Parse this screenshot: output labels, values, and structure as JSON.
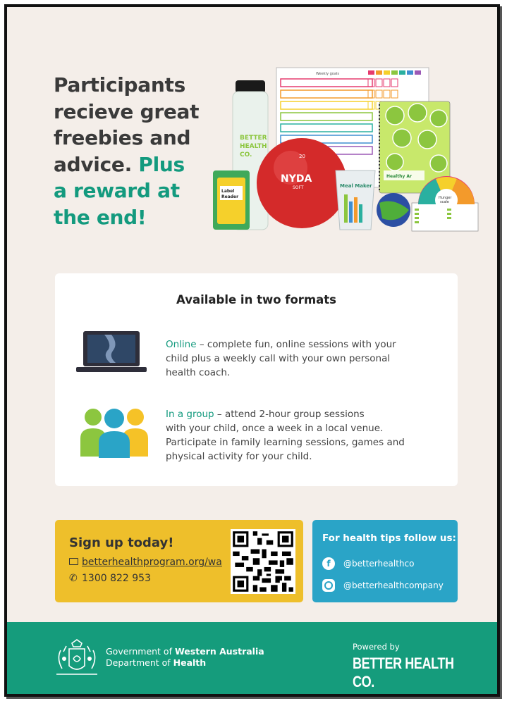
{
  "headline": {
    "line1": "Participants",
    "line2": "recieve great",
    "line3": "freebies and",
    "line4_start": "advice.",
    "line4_green": "Plus",
    "line5_green": "a reward at",
    "line6_green": "the end!"
  },
  "products": {
    "bottle_text_1": "BETTER",
    "bottle_text_2": "HEALTH",
    "bottle_text_3": "CO.",
    "planner_title": "Weekly goals",
    "ball_text": "NYDA",
    "ball_sub": "SOFT",
    "ball_number": "20",
    "card_text_1": "Label",
    "card_text_2": "Reader",
    "cup_text": "Meal Maker",
    "notebook_text": "Healthy Ar",
    "wheel_text_1": "Hunger",
    "wheel_text_2": "scale"
  },
  "formats": {
    "title": "Available in two formats",
    "online_label": "Online",
    "online_line1": " – complete fun, online sessions with your",
    "online_line2": "child plus a weekly call with your own personal",
    "online_line3": "health coach.",
    "group_label": "In a group",
    "group_line1": " – attend 2-hour group sessions",
    "group_line2": "with your child, once a week in a local venue.",
    "group_line3": "Participate in family learning sessions, games and",
    "group_line4": "physical activity for your child."
  },
  "signup": {
    "title": "Sign up today!",
    "link": "betterhealthprogram.org/wa",
    "phone": "1300 822 953"
  },
  "social": {
    "title": "For health tips follow us:",
    "facebook": "@betterhealthco",
    "instagram": "@betterhealthcompany"
  },
  "footer": {
    "gov_prefix": "Government of ",
    "gov_bold": "Western Australia",
    "dept_prefix": "Department of ",
    "dept_bold": "Health",
    "powered_by": "Powered by",
    "brand": "BETTER HEALTH CO."
  },
  "colors": {
    "background": "#f4eee9",
    "green": "#139a7e",
    "yellow": "#eebf2b",
    "blue": "#2aa4c7",
    "footer_green": "#159c7c"
  }
}
